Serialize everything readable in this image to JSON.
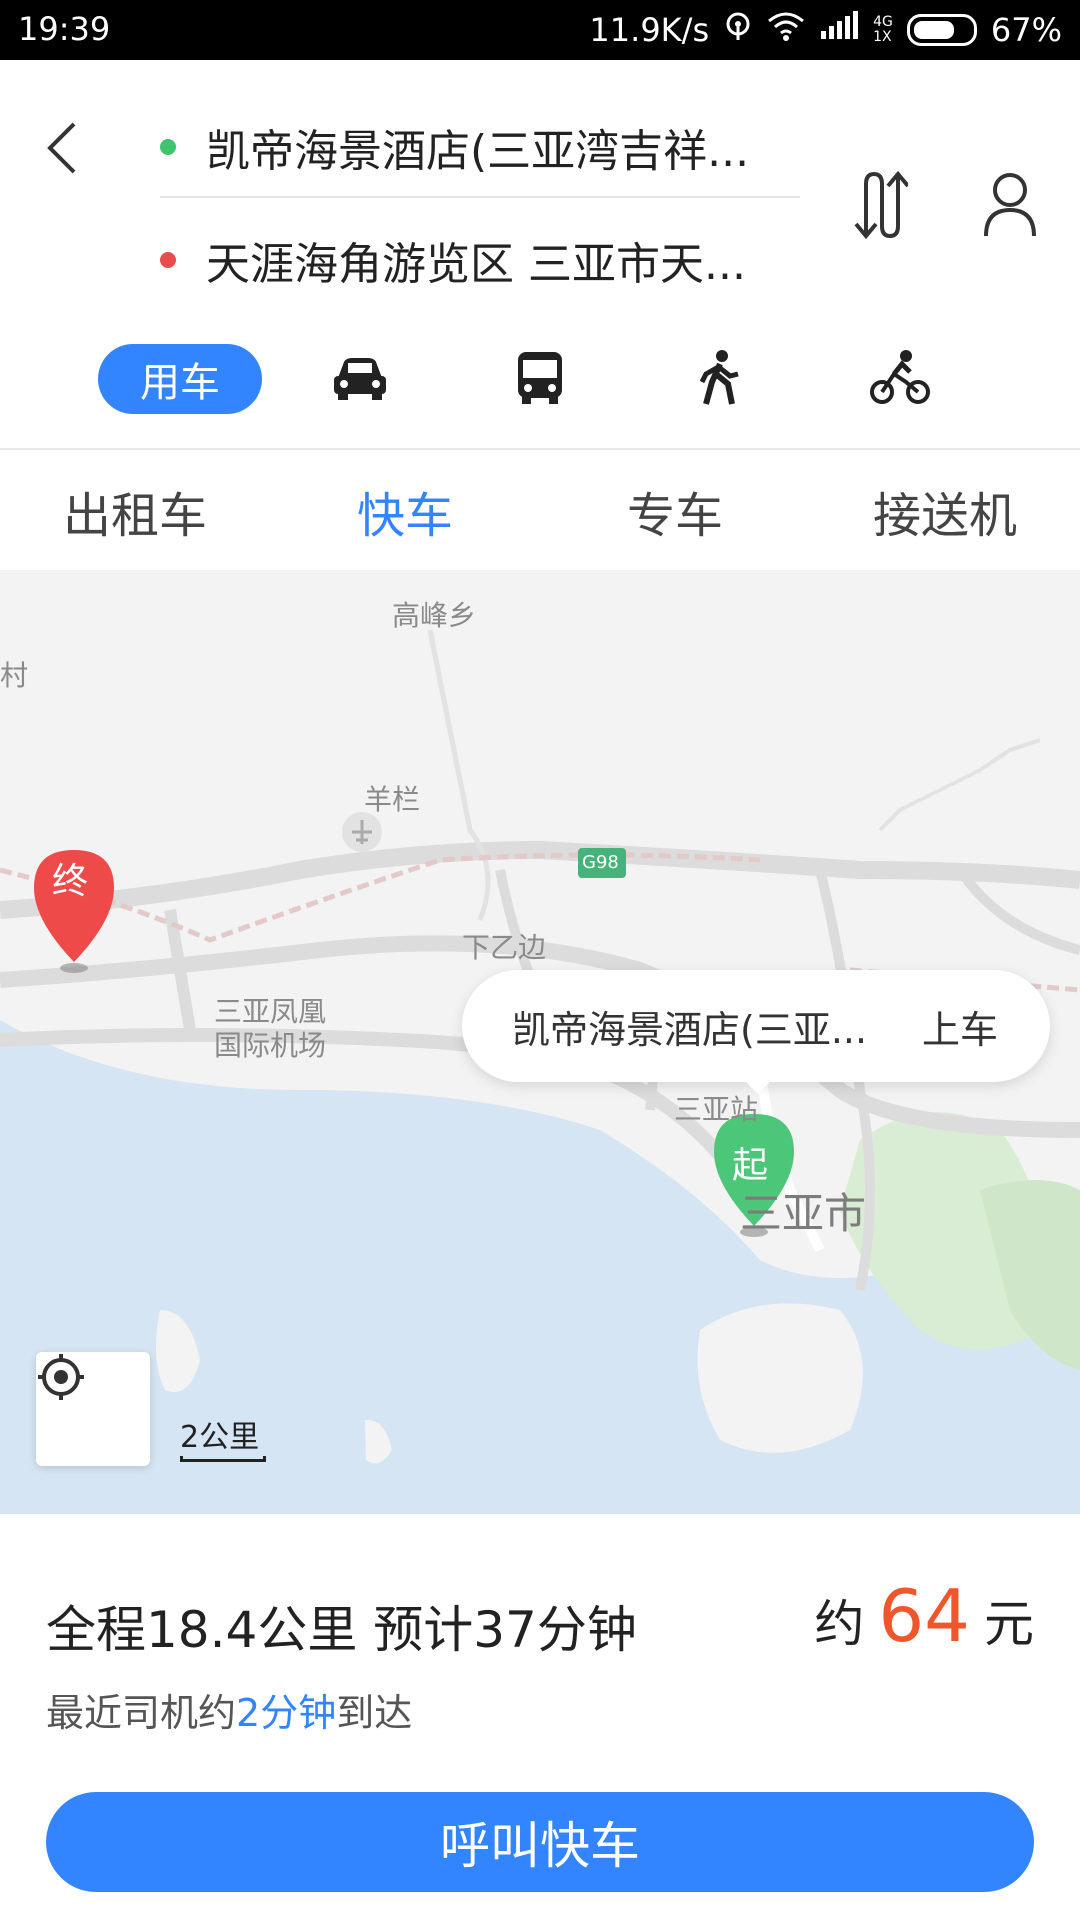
{
  "status_bar": {
    "time": "19:39",
    "network_speed": "11.9K/s",
    "network_type": "4G",
    "sim": "1X",
    "battery": "67%",
    "icons": [
      "hotspot-icon",
      "wifi-icon",
      "signal-icon",
      "battery-icon"
    ]
  },
  "route": {
    "start": "凯帝海景酒店(三亚湾吉祥...",
    "end": "天涯海角游览区 三亚市天...",
    "start_dot_color": "#3ec46d",
    "end_dot_color": "#e84c4c"
  },
  "modes": {
    "active_label": "用车",
    "icons": [
      "car-icon",
      "bus-icon",
      "walk-icon",
      "bike-icon"
    ]
  },
  "tabs": [
    {
      "label": "出租车",
      "active": false
    },
    {
      "label": "快车",
      "active": true
    },
    {
      "label": "专车",
      "active": false
    },
    {
      "label": "接送机",
      "active": false
    }
  ],
  "map": {
    "labels": {
      "gaofeng": "高峰乡",
      "cun": "村",
      "yanglan": "羊栏",
      "xiayibian": "下乙边",
      "g98": "G98",
      "airport_1": "三亚凤凰",
      "airport_2": "国际机场",
      "sanya_station": "三亚站",
      "sanya_city": "三亚市"
    },
    "start_marker": "起",
    "end_marker": "终",
    "callout": {
      "name": "凯帝海景酒店(三亚...",
      "action": "上车"
    },
    "scale": "2公里",
    "colors": {
      "land": "#f3f3f3",
      "sea": "#d5e5f3",
      "green": "#d9ecd4",
      "road": "#dcdcdc"
    }
  },
  "trip": {
    "summary": "全程18.4公里 预计37分钟",
    "price_prefix": "约",
    "price_value": "64",
    "price_unit": "元",
    "eta_prefix": "最近司机约",
    "eta_highlight": "2分钟",
    "eta_suffix": "到达"
  },
  "call_button": "呼叫快车",
  "accent": "#3385ff",
  "price_color": "#f0562c"
}
